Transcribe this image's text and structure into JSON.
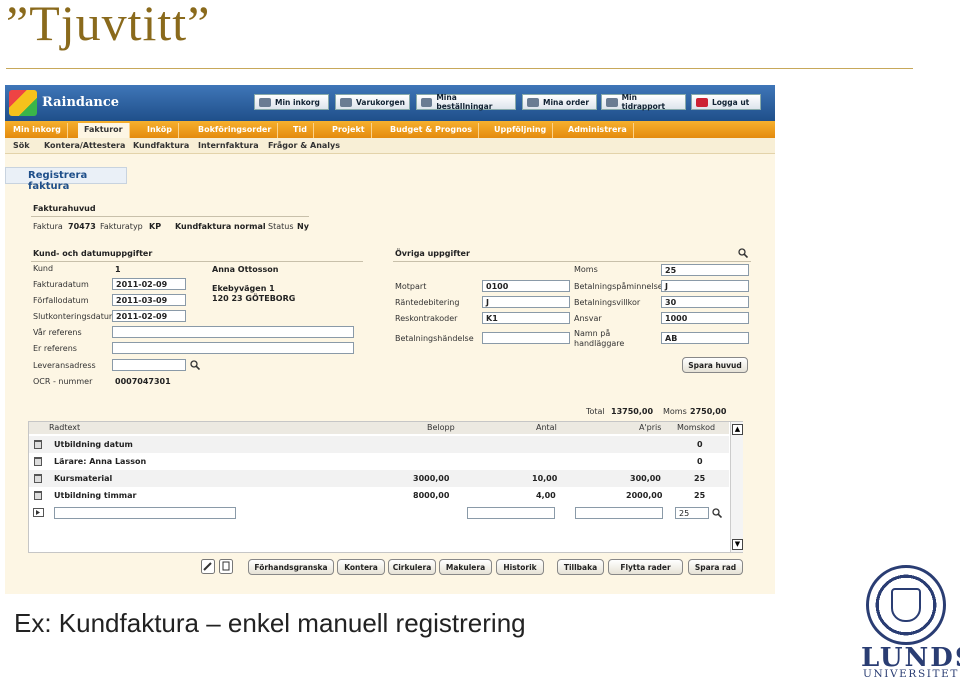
{
  "slide": {
    "title": "”Tjuvtitt”",
    "caption": "Ex: Kundfaktura – enkel manuell registrering",
    "logo_line1": "LUNDS",
    "logo_line2": "UNIVERSITET"
  },
  "app": {
    "name": "Raindance",
    "toolbar": [
      "Min inkorg",
      "Varukorgen",
      "Mina beställningar",
      "Mina order",
      "Min tidrapport",
      "Logga ut"
    ],
    "menu": [
      "Min inkorg",
      "Fakturor",
      "Inköp",
      "Bokföringsorder",
      "Tid",
      "Projekt",
      "Budget & Prognos",
      "Uppföljning",
      "Administrera"
    ],
    "submenu": [
      "Sök",
      "Kontera/Attestera",
      "Kundfaktura",
      "Internfaktura",
      "Frågor & Analys"
    ],
    "page_title": "Registrera faktura"
  },
  "header": {
    "section": "Fakturahuvud",
    "faktura_label": "Faktura",
    "faktura_value": "70473",
    "typ_label": "Fakturatyp",
    "typ_value": "KP",
    "name_value": "Kundfaktura normal",
    "status_label": "Status",
    "status_value": "Ny"
  },
  "kund": {
    "section": "Kund- och datumuppgifter",
    "kund_label": "Kund",
    "kund_value": "1",
    "kund_name": "Anna Ottosson",
    "address1": "Ekebyvägen 1",
    "address2": "120 23 GÖTEBORG",
    "fakturadatum_label": "Fakturadatum",
    "fakturadatum": "2011-02-09",
    "forfallodatum_label": "Förfallodatum",
    "forfallodatum": "2011-03-09",
    "slutkonteringsdatum_label": "Slutkonteringsdatum",
    "slutkonteringsdatum": "2011-02-09",
    "var_referens_label": "Vår referens",
    "var_referens": "",
    "er_referens_label": "Er referens",
    "er_referens": "",
    "leveransadress_label": "Leveransadress",
    "leveransadress": "",
    "ocr_label": "OCR - nummer",
    "ocr_value": "0007047301"
  },
  "ovriga": {
    "section": "Övriga uppgifter",
    "motpart_label": "Motpart",
    "motpart": "0100",
    "rantedebitering_label": "Räntedebitering",
    "rantedebitering": "J",
    "reskontrakoder_label": "Reskontrakoder",
    "reskontrakoder": "K1",
    "betalningshandelse_label": "Betalningshändelse",
    "betalningshandelse": "",
    "moms_label": "Moms",
    "moms": "25",
    "paminnelser_label": "Betalningspåminnelser",
    "paminnelser": "J",
    "villkor_label": "Betalningsvillkor",
    "villkor": "30",
    "ansvar_label": "Ansvar",
    "ansvar": "1000",
    "handlaggare_label1": "Namn på",
    "handlaggare_label2": "handläggare",
    "handlaggare": "AB",
    "spara_huvud": "Spara huvud"
  },
  "totals": {
    "total_label": "Total",
    "total": "13750,00",
    "moms_label": "Moms",
    "moms": "2750,00"
  },
  "rows": {
    "headers": [
      "Radtext",
      "Belopp",
      "Antal",
      "A'pris",
      "Momskod"
    ],
    "items": [
      {
        "text": "Utbildning datum",
        "belopp": "",
        "antal": "",
        "apris": "",
        "momskod": "0"
      },
      {
        "text": "Lärare: Anna Lasson",
        "belopp": "",
        "antal": "",
        "apris": "",
        "momskod": "0"
      },
      {
        "text": "Kursmaterial",
        "belopp": "3000,00",
        "antal": "10,00",
        "apris": "300,00",
        "momskod": "25"
      },
      {
        "text": "Utbildning timmar",
        "belopp": "8000,00",
        "antal": "4,00",
        "apris": "2000,00",
        "momskod": "25"
      }
    ],
    "new_row": {
      "text": "",
      "belopp": "",
      "antal": "",
      "apris": "",
      "momskod": "25"
    }
  },
  "actions": [
    "Förhandsgranska",
    "Kontera",
    "Cirkulera",
    "Makulera",
    "Historik",
    "Tillbaka",
    "Flytta rader",
    "Spara rad"
  ]
}
